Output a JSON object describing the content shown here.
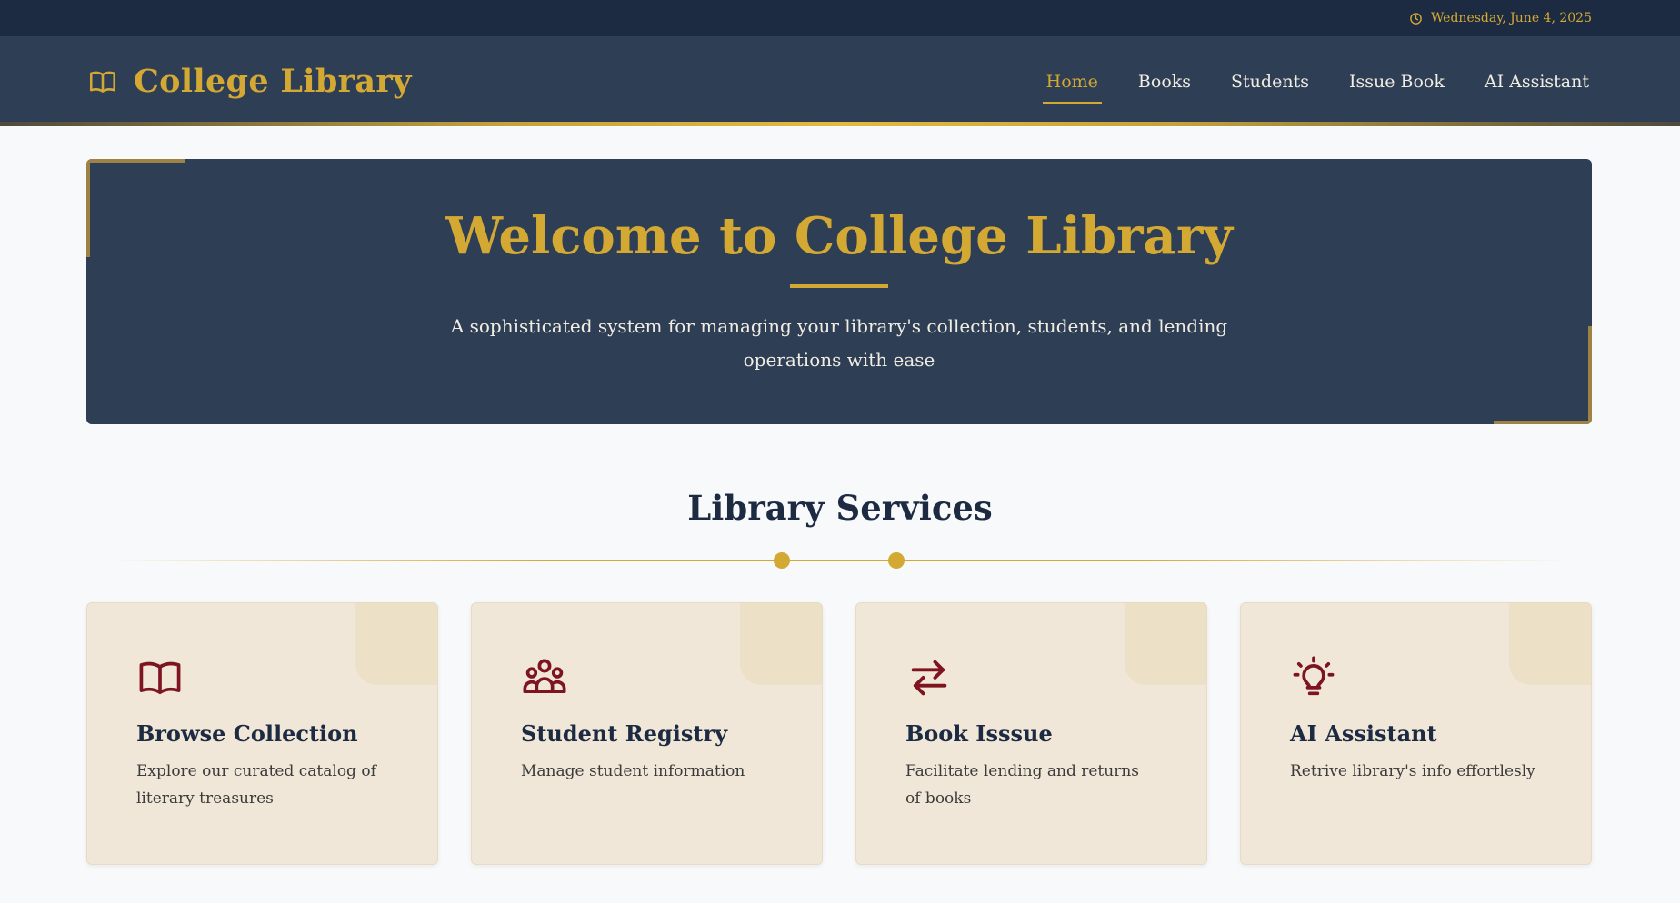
{
  "topbar": {
    "date": "Wednesday, June 4, 2025",
    "icon": "clock-icon"
  },
  "header": {
    "title": "College Library",
    "icon": "book-icon",
    "nav": [
      {
        "label": "Home",
        "active": true
      },
      {
        "label": "Books",
        "active": false
      },
      {
        "label": "Students",
        "active": false
      },
      {
        "label": "Issue Book",
        "active": false
      },
      {
        "label": "AI Assistant",
        "active": false
      }
    ]
  },
  "hero": {
    "title": "Welcome to College Library",
    "subtitle": "A sophisticated system for managing your library's collection, students, and lending operations with ease"
  },
  "services": {
    "title": "Library Services",
    "cards": [
      {
        "icon": "book-open-icon",
        "title": "Browse Collection",
        "desc": "Explore our curated catalog of literary treasures"
      },
      {
        "icon": "users-icon",
        "title": "Student Registry",
        "desc": "Manage student information"
      },
      {
        "icon": "arrows-exchange-icon",
        "title": "Book Isssue",
        "desc": "Facilitate lending and returns of books"
      },
      {
        "icon": "lightbulb-icon",
        "title": "AI Assistant",
        "desc": "Retrive library's info effortlesly"
      }
    ]
  },
  "colors": {
    "navy": "#2e3e55",
    "dark_navy": "#1c2b42",
    "gold": "#d4a933",
    "card_bg": "#f0e7d8",
    "maroon": "#7d1420"
  }
}
